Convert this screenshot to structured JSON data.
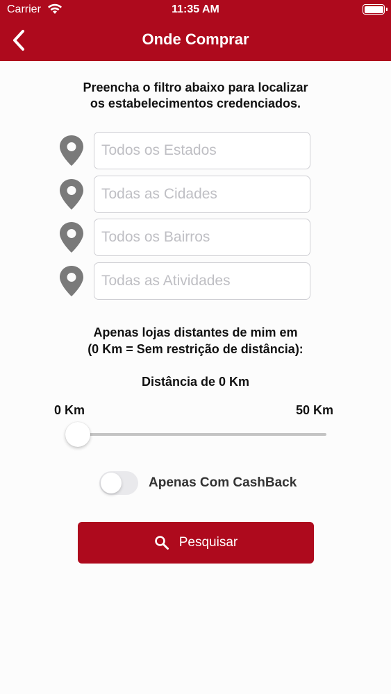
{
  "status_bar": {
    "carrier": "Carrier",
    "time": "11:35 AM",
    "wifi_icon": "wifi-icon",
    "battery_icon": "battery-icon"
  },
  "nav": {
    "title": "Onde Comprar",
    "back_icon": "chevron-left-icon"
  },
  "intro": {
    "line1": "Preencha o filtro abaixo para localizar",
    "line2": "os estabelecimentos credenciados."
  },
  "filters": [
    {
      "placeholder": "Todos os Estados",
      "value": "",
      "icon": "map-pin-icon"
    },
    {
      "placeholder": "Todas as Cidades",
      "value": "",
      "icon": "map-pin-icon"
    },
    {
      "placeholder": "Todos os Bairros",
      "value": "",
      "icon": "map-pin-icon"
    },
    {
      "placeholder": "Todas as Atividades",
      "value": "",
      "icon": "map-pin-icon"
    }
  ],
  "distance": {
    "description_line1": "Apenas lojas distantes de mim em",
    "description_line2": "(0 Km = Sem restrição de distância):",
    "current_label": "Distância de 0 Km",
    "min_label": "0 Km",
    "max_label": "50 Km",
    "value": 0,
    "min": 0,
    "max": 50
  },
  "cashback": {
    "label": "Apenas Com CashBack",
    "enabled": false
  },
  "search_button": {
    "label": "Pesquisar",
    "icon": "search-icon"
  },
  "colors": {
    "brand_red": "#ae0a1d",
    "pin_gray": "#7a7a7a",
    "background": "#fcfcfc"
  }
}
